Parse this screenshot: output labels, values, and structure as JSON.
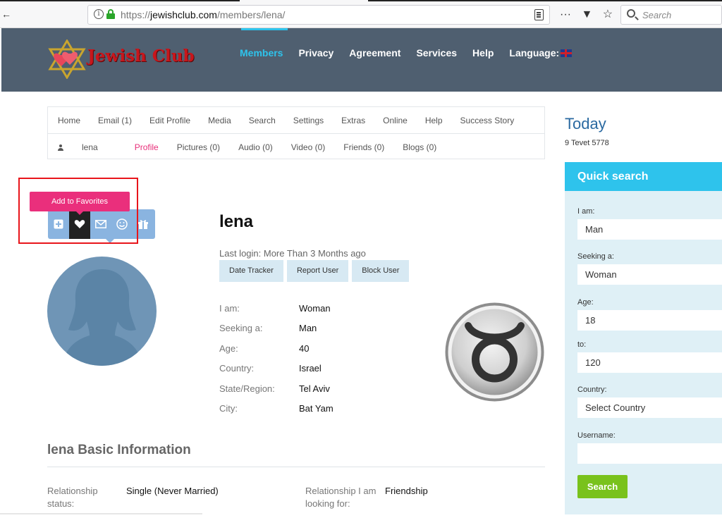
{
  "browser": {
    "url_prefix": "https://",
    "url_host": "jewishclub.com",
    "url_path": "/members/lena/",
    "search_placeholder": "Search",
    "tools": [
      "···",
      "pocket-icon",
      "star-icon"
    ]
  },
  "site": {
    "logo_text": "Jewish Club",
    "nav": [
      "Members",
      "Privacy",
      "Agreement",
      "Services",
      "Help",
      "Language:"
    ],
    "active_nav": "Members"
  },
  "subnav": {
    "row1": [
      "Home",
      "Email (1)",
      "Edit Profile",
      "Media",
      "Search",
      "Settings",
      "Extras",
      "Online",
      "Help",
      "Success Story"
    ],
    "row2": [
      "lena",
      "Profile",
      "Pictures (0)",
      "Audio (0)",
      "Video (0)",
      "Friends (0)",
      "Blogs (0)"
    ]
  },
  "actions": {
    "tooltip": "Add to Favorites",
    "icons": [
      "add-icon",
      "heart-icon",
      "mail-icon",
      "smile-icon",
      "gift-icon"
    ]
  },
  "profile": {
    "name": "lena",
    "last_login": "Last login: More Than 3 Months ago",
    "buttons": [
      "Date Tracker",
      "Report User",
      "Block User"
    ],
    "details": [
      {
        "label": "I am:",
        "value": "Woman"
      },
      {
        "label": "Seeking a:",
        "value": "Man"
      },
      {
        "label": "Age:",
        "value": "40"
      },
      {
        "label": "Country:",
        "value": "Israel"
      },
      {
        "label": "State/Region:",
        "value": "Tel Aviv"
      },
      {
        "label": "City:",
        "value": "Bat Yam"
      }
    ]
  },
  "basic_info": {
    "title": "lena Basic Information",
    "relationship_status_label": "Relationship status:",
    "relationship_status_value": "Single (Never Married)",
    "looking_for_label": "Relationship I am looking for:",
    "looking_for_value": "Friendship"
  },
  "today": {
    "title": "Today",
    "date": "9 Tevet 5778"
  },
  "quick_search": {
    "title": "Quick search",
    "i_am_label": "I am:",
    "i_am_value": "Man",
    "seeking_label": "Seeking a:",
    "seeking_value": "Woman",
    "age_label": "Age:",
    "age_from": "18",
    "to_label": "to:",
    "age_to": "120",
    "country_label": "Country:",
    "country_value": "Select Country",
    "username_label": "Username:",
    "username_value": "",
    "search_button": "Search"
  },
  "colors": {
    "header_bg": "#4f5f70",
    "accent_blue": "#2ec3ec",
    "pink": "#ea2f7c",
    "green": "#79c21c",
    "highlight_red": "#e8151b"
  }
}
